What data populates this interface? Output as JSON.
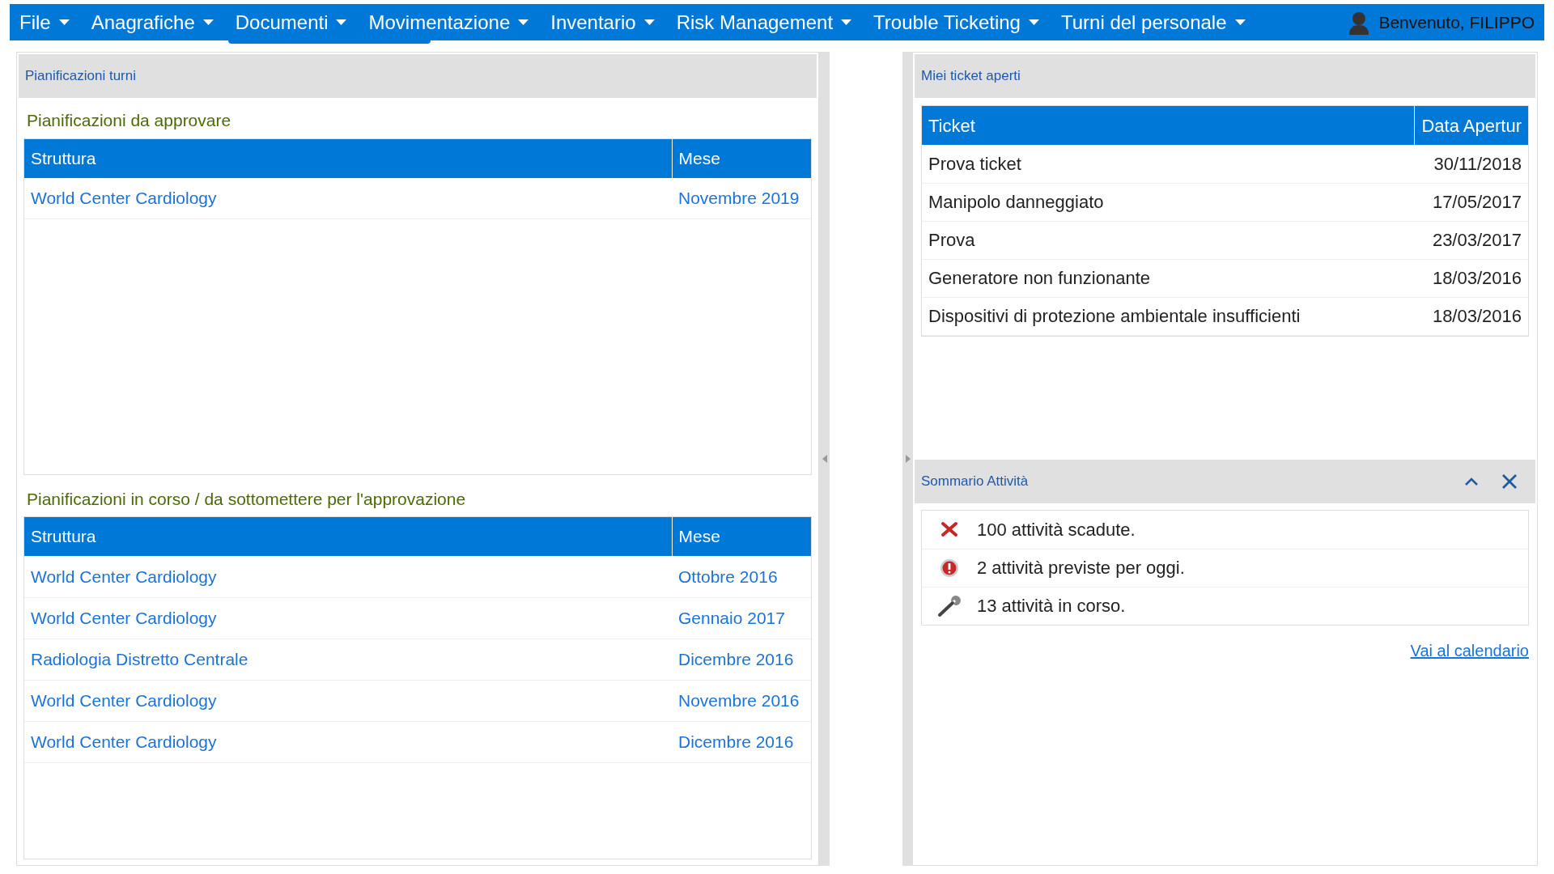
{
  "menu": {
    "items": [
      {
        "label": "File"
      },
      {
        "label": "Anagrafiche"
      },
      {
        "label": "Documenti"
      },
      {
        "label": "Movimentazione"
      },
      {
        "label": "Inventario"
      },
      {
        "label": "Risk Management"
      },
      {
        "label": "Trouble Ticketing"
      },
      {
        "label": "Turni del personale"
      }
    ],
    "user": "Benvenuto, FILIPPO"
  },
  "shifts_panel": {
    "title": "Pianificazioni turni",
    "sections": [
      {
        "title": "Pianificazioni da approvare",
        "columns": [
          "Struttura",
          "Mese"
        ],
        "rows": [
          [
            "World Center Cardiology",
            "Novembre 2019"
          ]
        ]
      },
      {
        "title": "Pianificazioni in corso / da sottomettere per l'approvazione",
        "columns": [
          "Struttura",
          "Mese"
        ],
        "rows": [
          [
            "World Center Cardiology",
            "Ottobre 2016"
          ],
          [
            "World Center Cardiology",
            "Gennaio 2017"
          ],
          [
            "Radiologia Distretto Centrale",
            "Dicembre 2016"
          ],
          [
            "World Center Cardiology",
            "Novembre 2016"
          ],
          [
            "World Center Cardiology",
            "Dicembre 2016"
          ]
        ]
      }
    ]
  },
  "tickets_panel": {
    "title": "Miei ticket aperti",
    "columns": [
      "Ticket",
      "Data Apertur"
    ],
    "rows": [
      [
        "Prova ticket",
        "30/11/2018"
      ],
      [
        "Manipolo danneggiato",
        "17/05/2017"
      ],
      [
        "Prova",
        "23/03/2017"
      ],
      [
        "Generatore non funzionante",
        "18/03/2016"
      ],
      [
        "Dispositivi di protezione ambientale insufficienti",
        "18/03/2016"
      ]
    ]
  },
  "activity_panel": {
    "title": "Sommario Attività",
    "items": [
      {
        "kind": "expired",
        "text": "100 attività scadute."
      },
      {
        "kind": "today",
        "text": "2 attività previste per oggi."
      },
      {
        "kind": "in_progress",
        "text": "13 attività in corso."
      }
    ],
    "link": "Vai al calendario"
  }
}
